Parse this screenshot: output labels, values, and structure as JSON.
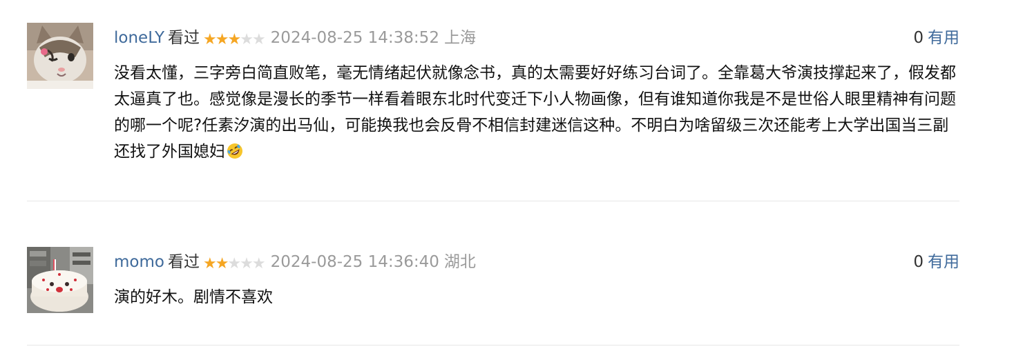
{
  "comments": [
    {
      "author": "loneLY",
      "status": "看过",
      "rating": 3,
      "max_rating": 5,
      "time": "2024-08-25 14:38:52",
      "location": "上海",
      "votes": "0",
      "vote_label": "有用",
      "text": "没看太懂，三字旁白简直败笔，毫无情绪起伏就像念书，真的太需要好好练习台词了。全靠葛大爷演技撑起来了，假发都太逼真了也。感觉像是漫长的季节一样看着眼东北时代变迁下小人物画像，但有谁知道你我是不是世俗人眼里精神有问题的哪一个呢?任素汐演的出马仙，可能换我也会反骨不相信封建迷信这种。不明白为啥留级三次还能考上大学出国当三副还找了外国媳妇",
      "emoji": "rolling-on-floor-laughing-emoji",
      "avatar": "cat-avatar"
    },
    {
      "author": "momo",
      "status": "看过",
      "rating": 2,
      "max_rating": 5,
      "time": "2024-08-25 14:36:40",
      "location": "湖北",
      "votes": "0",
      "vote_label": "有用",
      "text": "演的好木。剧情不喜欢",
      "avatar": "cake-avatar"
    }
  ],
  "colors": {
    "link": "#3f6a9b",
    "star_on": "#f5a623",
    "star_off": "#dcdcdc",
    "meta": "#9a9a9a",
    "divider": "#e6e6e6"
  }
}
